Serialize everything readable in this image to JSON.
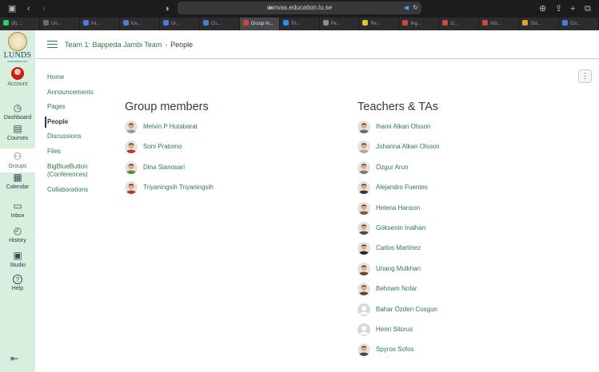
{
  "browser": {
    "url": "canvas.education.lu.se",
    "tabs": [
      {
        "label": "(8) ...",
        "color": "#25d366"
      },
      {
        "label": "Un...",
        "color": "#6b6b70"
      },
      {
        "label": "mi...",
        "color": "#4a7dd8"
      },
      {
        "label": "Ice...",
        "color": "#4a7dd8"
      },
      {
        "label": "Ur...",
        "color": "#4a7dd8"
      },
      {
        "label": "Co...",
        "color": "#4a7dd8"
      },
      {
        "label": "Group m...",
        "color": "#d94040",
        "active": true
      },
      {
        "label": "Th...",
        "color": "#2d8cff"
      },
      {
        "label": "Pe...",
        "color": "#8c8c92"
      },
      {
        "label": "Pe...",
        "color": "#e8c230"
      },
      {
        "label": "Ing...",
        "color": "#d44638"
      },
      {
        "label": "G...",
        "color": "#d44638"
      },
      {
        "label": "Inb...",
        "color": "#d44638"
      },
      {
        "label": "Sol...",
        "color": "#f0a020"
      },
      {
        "label": "Go...",
        "color": "#4a7dd8"
      }
    ]
  },
  "logo": {
    "name": "LUNDS",
    "sub": "UNIVERSITET"
  },
  "global_nav": [
    {
      "key": "account",
      "label": "Account",
      "icon": "avatar-icon"
    },
    {
      "key": "dashboard",
      "label": "Dashboard",
      "icon": "dashboard-icon"
    },
    {
      "key": "courses",
      "label": "Courses",
      "icon": "courses-icon"
    },
    {
      "key": "groups",
      "label": "Groups",
      "icon": "groups-icon",
      "active": true
    },
    {
      "key": "calendar",
      "label": "Calendar",
      "icon": "calendar-icon"
    },
    {
      "key": "inbox",
      "label": "Inbox",
      "icon": "inbox-icon"
    },
    {
      "key": "history",
      "label": "History",
      "icon": "history-icon"
    },
    {
      "key": "studio",
      "label": "Studio",
      "icon": "studio-icon"
    },
    {
      "key": "help",
      "label": "Help",
      "icon": "help-icon"
    }
  ],
  "breadcrumb": {
    "course": "Team 1: Bappeda Jambi Team",
    "current": "People"
  },
  "course_nav": [
    {
      "label": "Home"
    },
    {
      "label": "Announcements"
    },
    {
      "label": "Pages"
    },
    {
      "label": "People",
      "active": true
    },
    {
      "label": "Discussions"
    },
    {
      "label": "Files"
    },
    {
      "label": "BigBlueButton (Conferences)"
    },
    {
      "label": "Collaborations"
    }
  ],
  "group_members": {
    "title": "Group members",
    "people": [
      {
        "name": "Melvin P Hutabarat",
        "avatar": "#9a9a9a"
      },
      {
        "name": "Soni Pratomo",
        "avatar": "#c0392b"
      },
      {
        "name": "Dina Sianosari",
        "avatar": "#5b8c3a"
      },
      {
        "name": "Triyaningsih Triyaningsih",
        "avatar": "#c0392b"
      }
    ]
  },
  "teachers": {
    "title": "Teachers & TAs",
    "people": [
      {
        "name": "Ihami Alkan Olsson",
        "avatar": "#6b6b6b"
      },
      {
        "name": "Johanna Alkan Olsson",
        "avatar": "#b8a99a"
      },
      {
        "name": "Özgur Arun",
        "avatar": "#8a7a6a"
      },
      {
        "name": "Alejandro Fuentes",
        "avatar": "#3a3a3a"
      },
      {
        "name": "Helena Hanson",
        "avatar": "#7a5a4a"
      },
      {
        "name": "Göksenin Inalhan",
        "avatar": "#4a4a4a"
      },
      {
        "name": "Carlos Martinez",
        "avatar": "#2a2a2a"
      },
      {
        "name": "Unang Mulkhan",
        "avatar": "#6a4a2a"
      },
      {
        "name": "Behnam Nofar",
        "avatar": "#5a4a3a"
      },
      {
        "name": "Bahar Özden Cosgun",
        "avatar": "#c4c4c4"
      },
      {
        "name": "Henri Sitorus",
        "avatar": "#c4c4c4"
      },
      {
        "name": "Spyros Sofos",
        "avatar": "#4a4a4a"
      }
    ]
  }
}
